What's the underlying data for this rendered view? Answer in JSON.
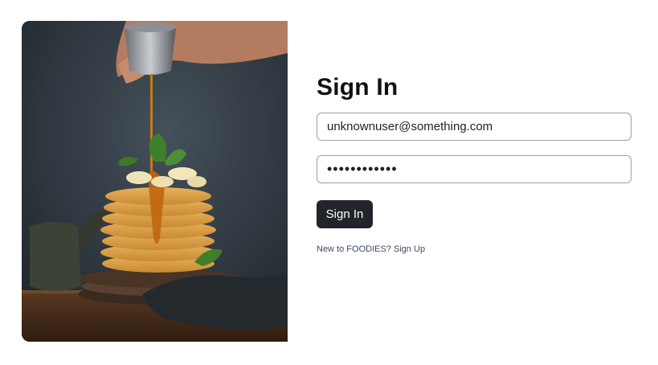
{
  "hero": {
    "image": "pancake-stack-syrup-photo"
  },
  "signin": {
    "title": "Sign In",
    "email_value": "unknownuser@something.com",
    "password_value": "••••••••••••",
    "button_label": "Sign In"
  },
  "signup": {
    "prompt": "New to FOODIES?",
    "link_label": "Sign Up"
  },
  "colors": {
    "button_bg": "#212529",
    "link": "#3b4a66",
    "input_border": "#9aa0a6"
  }
}
